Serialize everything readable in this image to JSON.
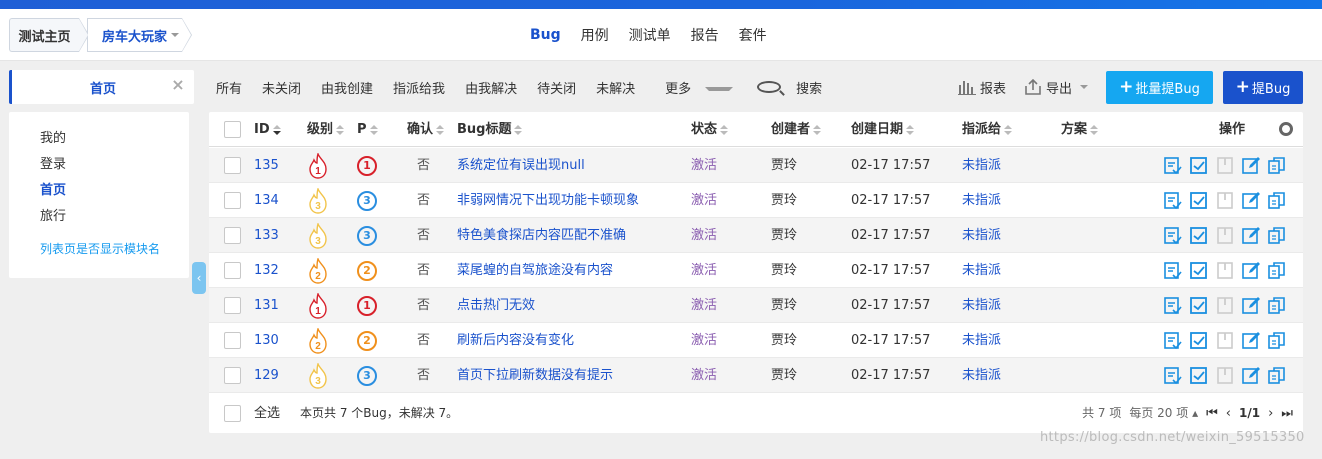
{
  "breadcrumb": {
    "home": "测试主页",
    "project": "房车大玩家"
  },
  "nav": {
    "items": [
      "Bug",
      "用例",
      "测试单",
      "报告",
      "套件"
    ],
    "active": "Bug"
  },
  "subbar": {
    "tab_label": "首页",
    "filters": [
      "所有",
      "未关闭",
      "由我创建",
      "指派给我",
      "由我解决",
      "待关闭",
      "未解决",
      "更多"
    ],
    "search": "搜索",
    "report": "报表",
    "export": "导出",
    "batch_button": "批量提Bug",
    "add_button": "提Bug"
  },
  "sidebar": {
    "items": [
      "我的",
      "登录",
      "首页",
      "旅行"
    ],
    "active": "首页",
    "settings_link": "列表页是否显示模块名"
  },
  "table": {
    "headers": {
      "id": "ID",
      "severity": "级别",
      "pri": "P",
      "confirm": "确认",
      "title": "Bug标题",
      "status": "状态",
      "creator": "创建者",
      "date": "创建日期",
      "assign": "指派给",
      "plan": "方案",
      "actions": "操作"
    },
    "rows": [
      {
        "id": "135",
        "severity": "1",
        "pri": "1",
        "confirm": "否",
        "title": "系统定位有误出现null",
        "status": "激活",
        "creator": "贾玲",
        "date": "02-17 17:57",
        "assign": "未指派"
      },
      {
        "id": "134",
        "severity": "3",
        "pri": "3",
        "confirm": "否",
        "title": "非弱网情况下出现功能卡顿现象",
        "status": "激活",
        "creator": "贾玲",
        "date": "02-17 17:57",
        "assign": "未指派"
      },
      {
        "id": "133",
        "severity": "3",
        "pri": "3",
        "confirm": "否",
        "title": "特色美食探店内容匹配不准确",
        "status": "激活",
        "creator": "贾玲",
        "date": "02-17 17:57",
        "assign": "未指派"
      },
      {
        "id": "132",
        "severity": "2",
        "pri": "2",
        "confirm": "否",
        "title": "菜尾蝗的自驾旅途没有内容",
        "status": "激活",
        "creator": "贾玲",
        "date": "02-17 17:57",
        "assign": "未指派"
      },
      {
        "id": "131",
        "severity": "1",
        "pri": "1",
        "confirm": "否",
        "title": "点击热门无效",
        "status": "激活",
        "creator": "贾玲",
        "date": "02-17 17:57",
        "assign": "未指派"
      },
      {
        "id": "130",
        "severity": "2",
        "pri": "2",
        "confirm": "否",
        "title": "刷新后内容没有变化",
        "status": "激活",
        "creator": "贾玲",
        "date": "02-17 17:57",
        "assign": "未指派"
      },
      {
        "id": "129",
        "severity": "3",
        "pri": "3",
        "confirm": "否",
        "title": "首页下拉刷新数据没有提示",
        "status": "激活",
        "creator": "贾玲",
        "date": "02-17 17:57",
        "assign": "未指派"
      }
    ]
  },
  "footer": {
    "select_all": "全选",
    "summary": "本页共 7 个Bug，未解决 7。",
    "total": "共 7 项",
    "per_page": "每页 20 项",
    "page": "1/1"
  },
  "watermark": "https://blog.csdn.net/weixin_59515350",
  "colors": {
    "primary": "#1a52cc",
    "accent": "#15a7f1",
    "p1": "#d8202a",
    "p2": "#f0901c",
    "p3": "#2a8ee0",
    "status": "#8a5db0"
  }
}
